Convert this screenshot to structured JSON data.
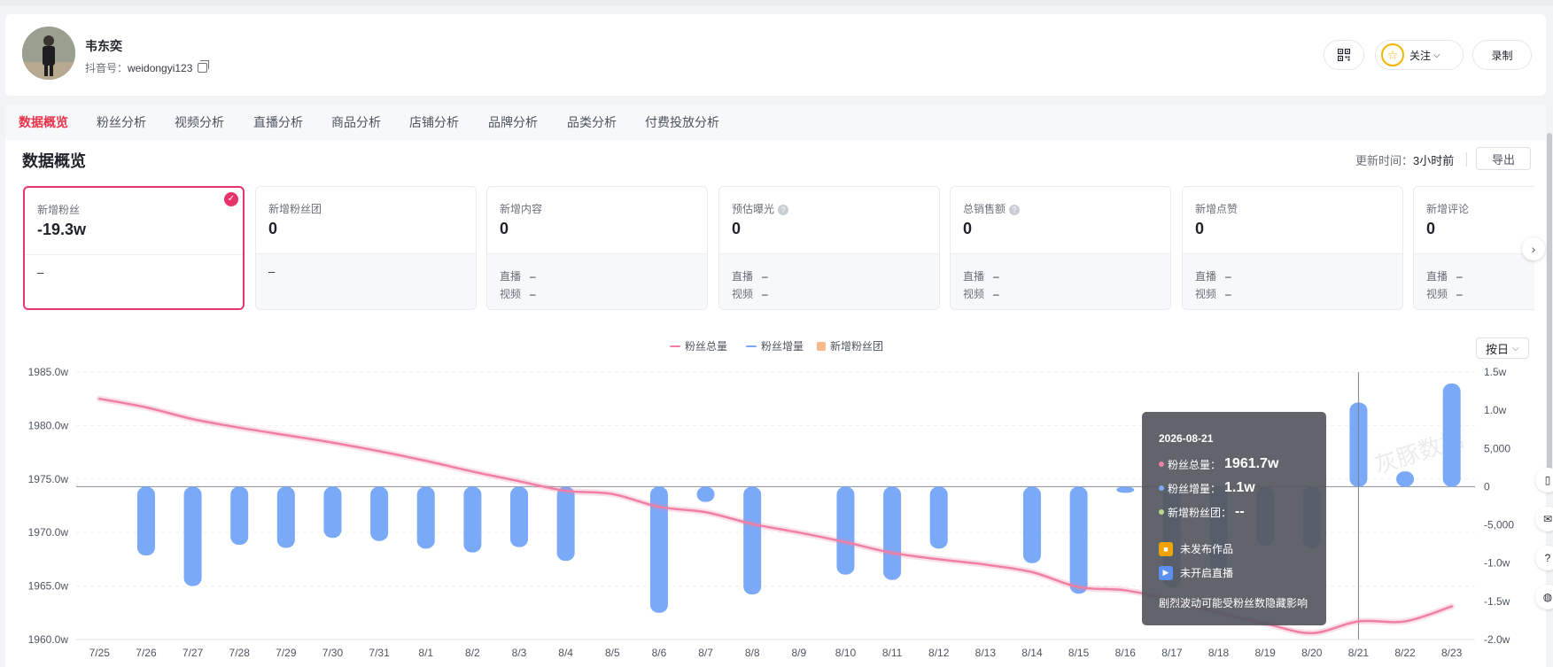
{
  "profile": {
    "name": "韦东奕",
    "id_label": "抖音号：",
    "id_value": "weidongyi123",
    "follow_label": "关注",
    "record_label": "录制"
  },
  "tabs": [
    {
      "label": "数据概览",
      "active": true
    },
    {
      "label": "粉丝分析"
    },
    {
      "label": "视频分析"
    },
    {
      "label": "直播分析"
    },
    {
      "label": "商品分析"
    },
    {
      "label": "店铺分析"
    },
    {
      "label": "品牌分析"
    },
    {
      "label": "品类分析"
    },
    {
      "label": "付费投放分析"
    }
  ],
  "overview": {
    "title": "数据概览",
    "update_label": "更新时间：",
    "update_value": "3小时前",
    "export_label": "导出"
  },
  "cards": [
    {
      "label": "新增粉丝",
      "value": "-19.3w",
      "selected": true,
      "dash": "–"
    },
    {
      "label": "新增粉丝团",
      "value": "0",
      "dash": "–"
    },
    {
      "label": "新增内容",
      "value": "0",
      "live_label": "直播",
      "live": "–",
      "video_label": "视频",
      "video": "–"
    },
    {
      "label": "预估曝光",
      "value": "0",
      "help": "?",
      "live_label": "直播",
      "live": "–",
      "video_label": "视频",
      "video": "–"
    },
    {
      "label": "总销售额",
      "value": "0",
      "help": "?",
      "live_label": "直播",
      "live": "–",
      "video_label": "视频",
      "video": "–"
    },
    {
      "label": "新增点赞",
      "value": "0",
      "live_label": "直播",
      "live": "–",
      "video_label": "视频",
      "video": "–"
    },
    {
      "label": "新增评论",
      "value": "0",
      "live_label": "直播",
      "live": "–",
      "video_label": "视频",
      "video": "–"
    }
  ],
  "chart_controls": {
    "period": "按日"
  },
  "chart_data": {
    "type": "bar+line",
    "legend": [
      "粉丝总量",
      "粉丝增量",
      "新增粉丝团"
    ],
    "colors": {
      "total": "#f07fa4",
      "increment": "#79a9f7",
      "fanclub": "#f7b98a"
    },
    "categories": [
      "7/25",
      "7/26",
      "7/27",
      "7/28",
      "7/29",
      "7/30",
      "7/31",
      "8/1",
      "8/2",
      "8/3",
      "8/4",
      "8/5",
      "8/6",
      "8/7",
      "8/8",
      "8/9",
      "8/10",
      "8/11",
      "8/12",
      "8/13",
      "8/14",
      "8/15",
      "8/16",
      "8/17",
      "8/18",
      "8/19",
      "8/20",
      "8/21",
      "8/22",
      "8/23"
    ],
    "series": [
      {
        "name": "粉丝总量",
        "axis": "left",
        "type": "line",
        "values": [
          1982.5,
          1981.7,
          1980.6,
          1979.8,
          1979.1,
          1978.4,
          1977.6,
          1976.7,
          1975.7,
          1974.8,
          1973.9,
          1973.6,
          1972.4,
          1971.9,
          1970.8,
          1970.0,
          1969.1,
          1968.1,
          1967.5,
          1967.0,
          1966.3,
          1964.9,
          1964.6,
          1963.7,
          1962.5,
          1961.5,
          1960.6,
          1961.7,
          1961.7,
          1963.1
        ]
      },
      {
        "name": "粉丝增量",
        "axis": "right",
        "type": "bar",
        "values": [
          0,
          -9000,
          -13000,
          -7600,
          -8000,
          -6700,
          -7100,
          -8100,
          -8600,
          -7900,
          -9700,
          0,
          -16500,
          -2000,
          -14100,
          0,
          -11500,
          -12200,
          -8100,
          0,
          -10000,
          -14000,
          -800,
          -13200,
          -11000,
          -7700,
          -8000,
          11000,
          2000,
          13500
        ]
      }
    ],
    "y_left": {
      "ticks": [
        "1960.0w",
        "1965.0w",
        "1970.0w",
        "1975.0w",
        "1980.0w",
        "1985.0w"
      ],
      "range": [
        1960,
        1985
      ]
    },
    "y_right": {
      "ticks": [
        "-2.0w",
        "-1.5w",
        "-1.0w",
        "-5,000",
        "0",
        "5,000",
        "1.0w",
        "1.5w"
      ],
      "range": [
        -20000,
        15000
      ]
    },
    "watermark": "灰豚数据",
    "tooltip": {
      "date": "2026-08-21",
      "total_label": "粉丝总量：",
      "total_value": "1961.7w",
      "inc_label": "粉丝增量：",
      "inc_value": "1.1w",
      "club_label": "新增粉丝团：",
      "club_value": "--",
      "no_video": "未发布作品",
      "no_live": "未开启直播",
      "note": "剧烈波动可能受粉丝数隐藏影响"
    }
  }
}
